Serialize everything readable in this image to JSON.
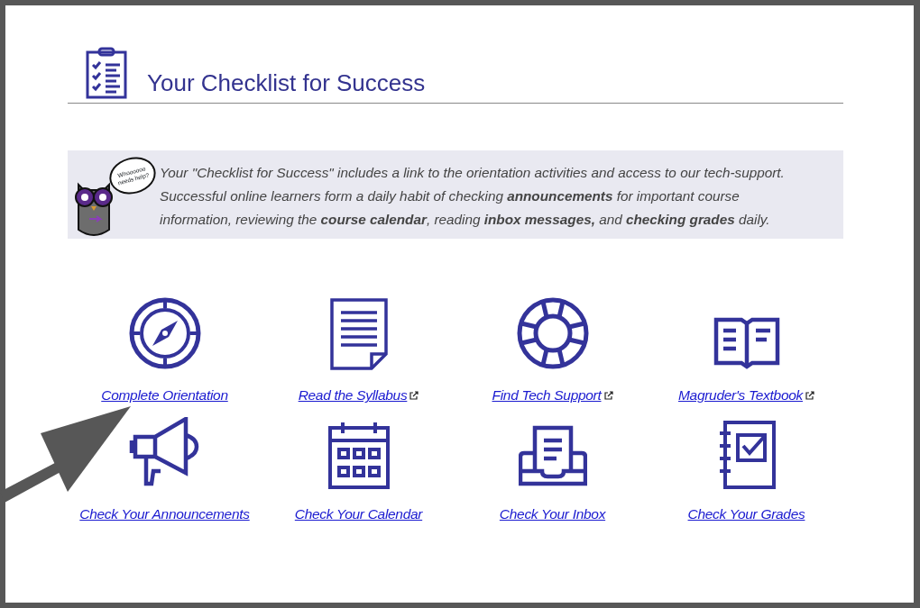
{
  "header": {
    "title": "Your Checklist for Success"
  },
  "intro": {
    "bubble": "Whoooooo needs help?",
    "text": "Your \"Checklist for Success\" includes a link to the orientation activities and access to our tech-support. Successful online learners form a daily habit of checking **announcements** for important course information, reviewing the **course calendar**, reading **inbox messages,** and **checking grades** daily."
  },
  "links": [
    {
      "kind": "compass",
      "label": "Complete Orientation",
      "external": false
    },
    {
      "kind": "document",
      "label": "Read the Syllabus",
      "external": true
    },
    {
      "kind": "lifebuoy",
      "label": "Find Tech Support",
      "external": true
    },
    {
      "kind": "book",
      "label": "Magruder's Textbook",
      "external": true
    },
    {
      "kind": "megaphone",
      "label": "Check Your Announcements",
      "external": false
    },
    {
      "kind": "calendar",
      "label": "Check Your Calendar",
      "external": false
    },
    {
      "kind": "inbox",
      "label": "Check Your Inbox",
      "external": false
    },
    {
      "kind": "notebook",
      "label": "Check Your Grades",
      "external": false
    }
  ]
}
